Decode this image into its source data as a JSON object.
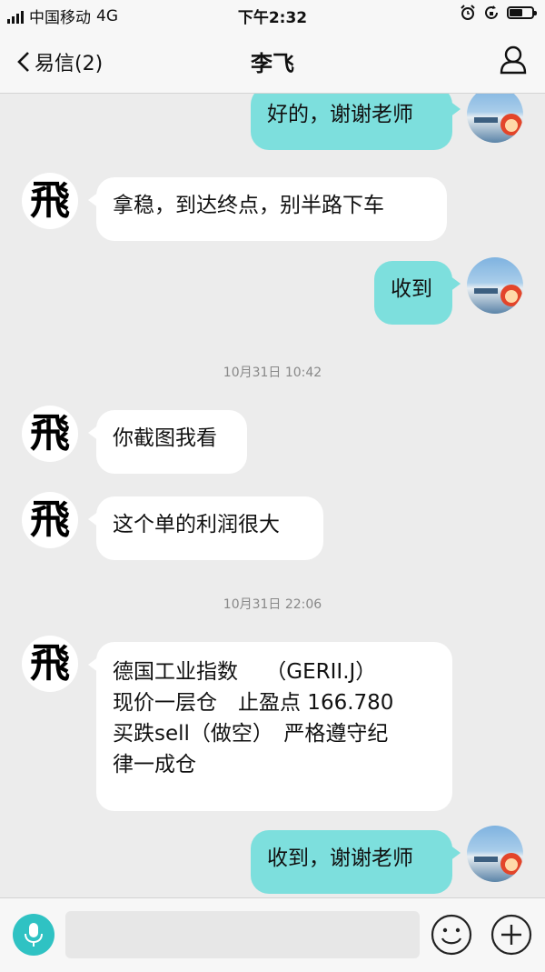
{
  "status_bar": {
    "carrier": "中国移动",
    "network": "4G",
    "time": "下午2:32",
    "battery_level": 0.6
  },
  "nav": {
    "back_label": "易信(2)",
    "title": "李飞"
  },
  "avatars": {
    "contact_glyph": "飛"
  },
  "messages": [
    {
      "dir": "out",
      "text": "好的，谢谢老师"
    },
    {
      "dir": "in",
      "text": "拿稳，到达终点，别半路下车"
    },
    {
      "dir": "out",
      "text": "收到"
    },
    {
      "dir": "time",
      "text": "10月31日 10:42"
    },
    {
      "dir": "in",
      "text": "你截图我看"
    },
    {
      "dir": "in",
      "text": "这个单的利润很大"
    },
    {
      "dir": "time",
      "text": "10月31日 22:06"
    },
    {
      "dir": "in",
      "lines": [
        "德国工业指数　 （GERII.J）",
        "现价一层仓　止盈点 166.780",
        "买跌sell（做空）　严格遵守纪",
        "律一成仓"
      ]
    },
    {
      "dir": "out",
      "text": "收到，谢谢老师"
    }
  ],
  "input": {
    "placeholder": ""
  },
  "colors": {
    "accent": "#2fc2c3",
    "outgoing_bubble": "#7ddfdd",
    "incoming_bubble": "#ffffff",
    "chat_background": "#ececec"
  }
}
